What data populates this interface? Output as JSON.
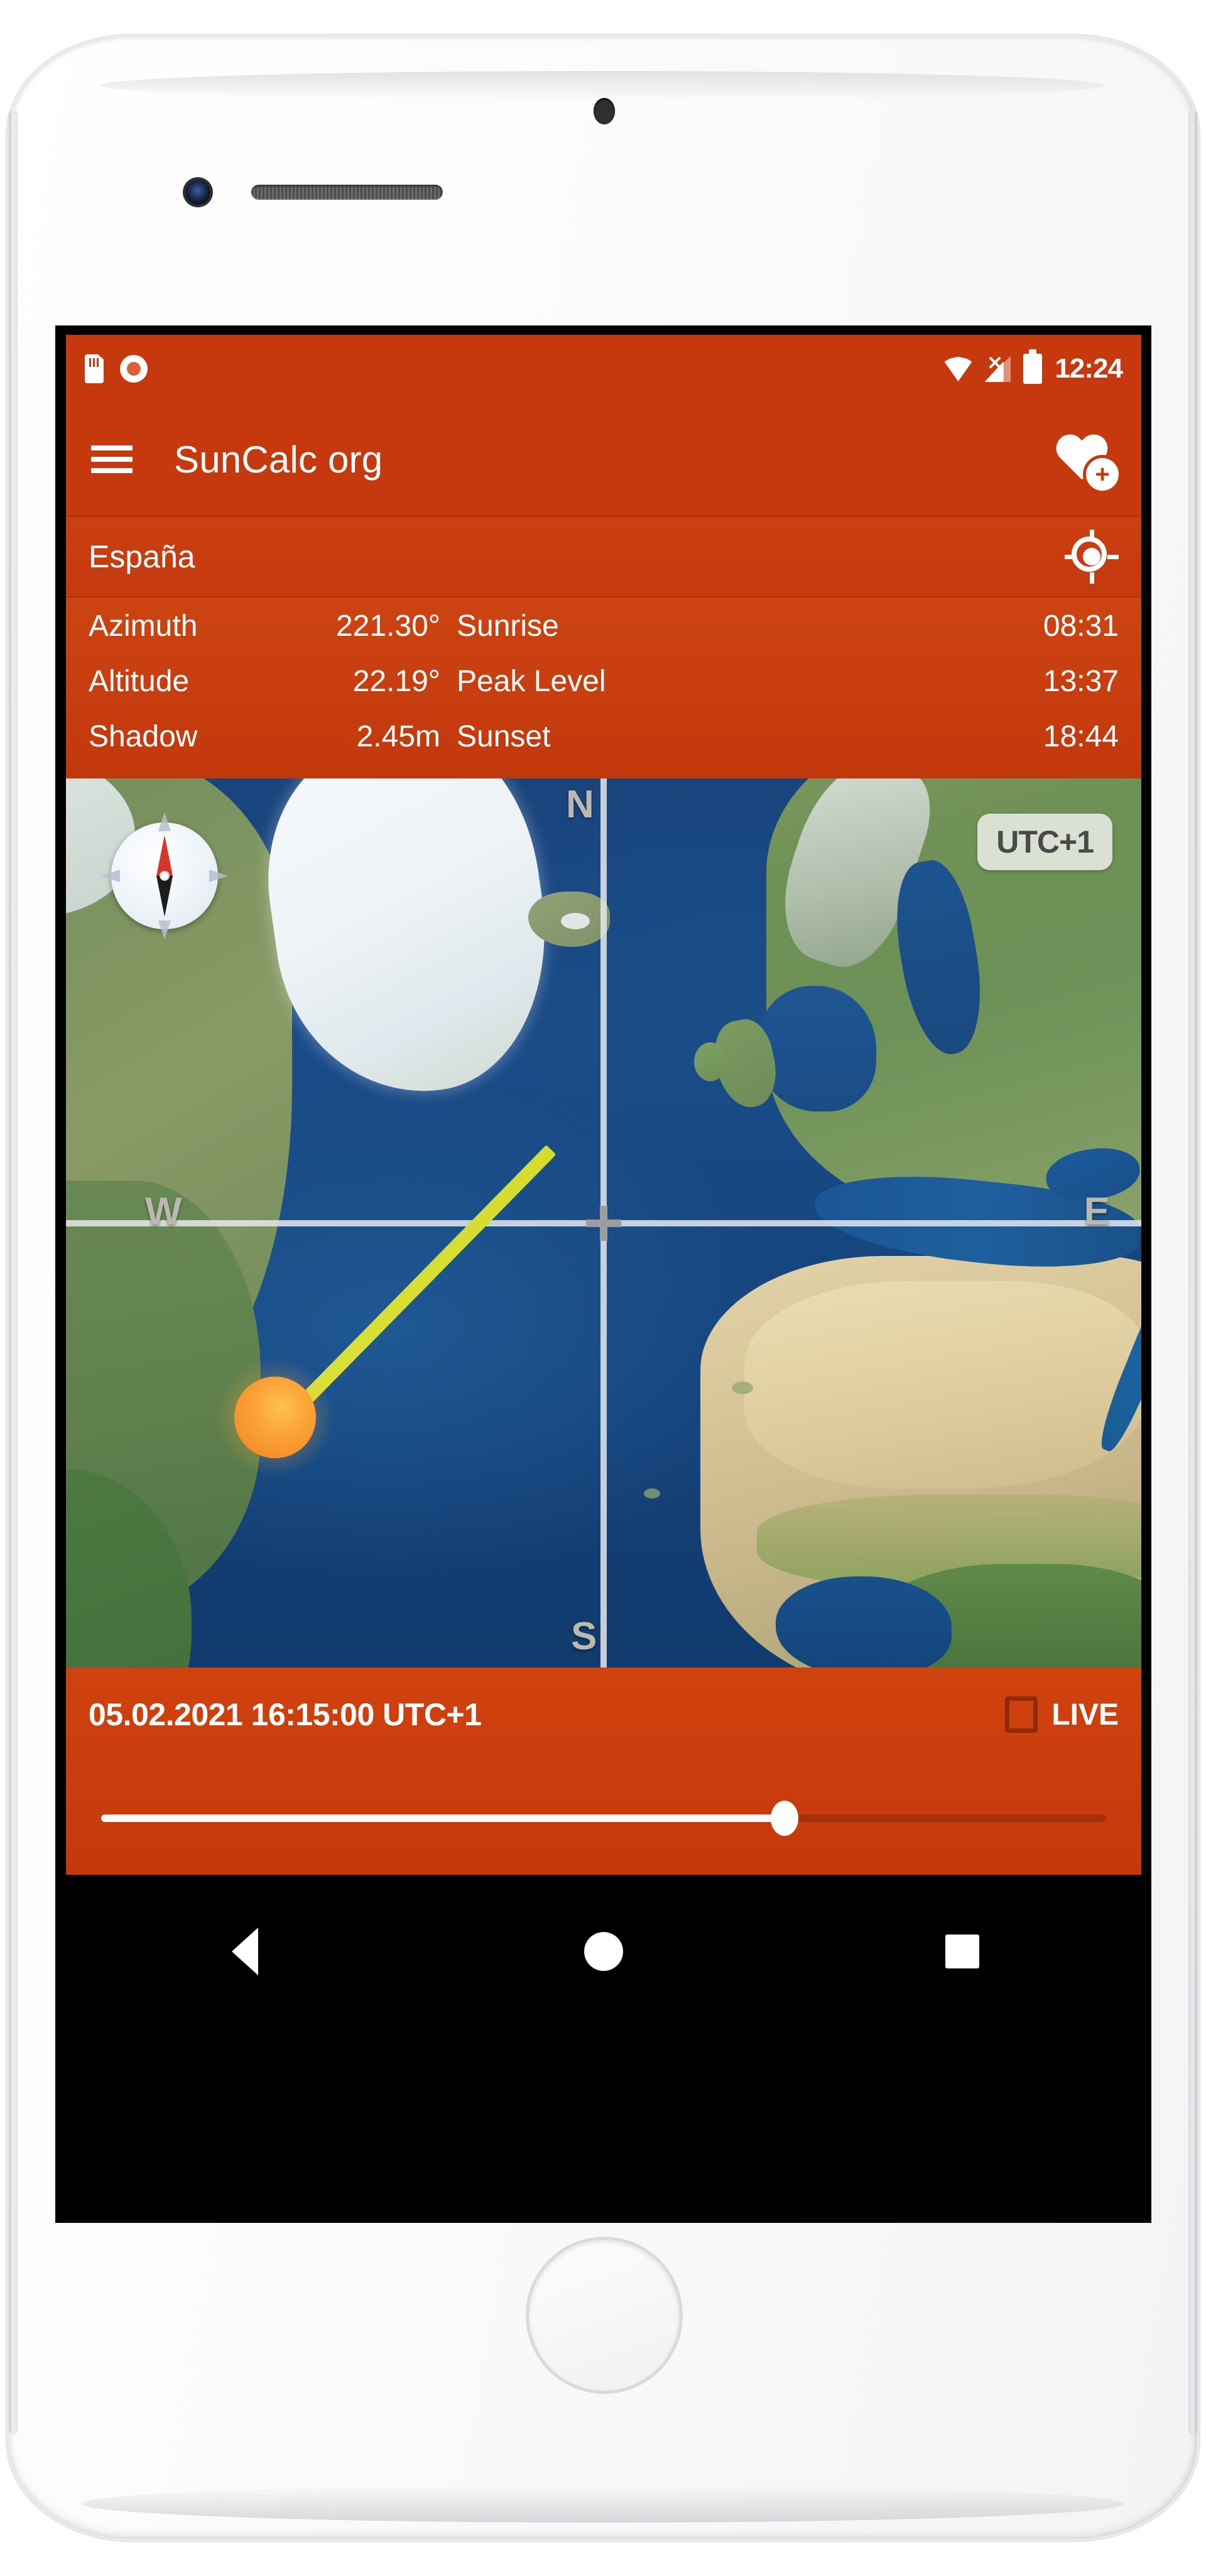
{
  "status_bar": {
    "icons_left": [
      "sd-card-icon",
      "record-icon"
    ],
    "icons_right": [
      "wifi-icon",
      "no-signal-icon",
      "battery-icon"
    ],
    "time": "12:24"
  },
  "app_bar": {
    "menu_icon": "hamburger-menu-icon",
    "title": "SunCalc org",
    "favorite_icon": "heart-plus-icon"
  },
  "location_bar": {
    "name": "España",
    "gps_icon": "gps-crosshair-icon"
  },
  "data_panel": {
    "rows": [
      {
        "label": "Azimuth",
        "value": "221.30°",
        "label2": "Sunrise",
        "value2": "08:31"
      },
      {
        "label": "Altitude",
        "value": "22.19°",
        "label2": "Peak Level",
        "value2": "13:37"
      },
      {
        "label": "Shadow",
        "value": "2.45m",
        "label2": "Sunset",
        "value2": "18:44"
      }
    ]
  },
  "map": {
    "compass_labels": {
      "north": "N",
      "south": "S",
      "west": "W",
      "east": "E"
    },
    "timezone_badge": "UTC+1",
    "compass_rose_icon": "compass-rose-icon",
    "sun_marker_icon": "sun-marker-icon",
    "sun_ray_icon": "sun-ray-line"
  },
  "bottom_bar": {
    "datetime": "05.02.2021 16:15:00 UTC+1",
    "live_label": "LIVE",
    "live_checked": false,
    "slider_percent": 68
  },
  "nav_bar": {
    "back_icon": "back-triangle-icon",
    "home_icon": "home-circle-icon",
    "recents_icon": "recents-square-icon"
  },
  "colors": {
    "primary": "#c6380d",
    "primary_dark": "#a33210",
    "accent_sun": "#f2821f",
    "ray": "#d4dc2e",
    "ocean": "#1a4c89"
  }
}
